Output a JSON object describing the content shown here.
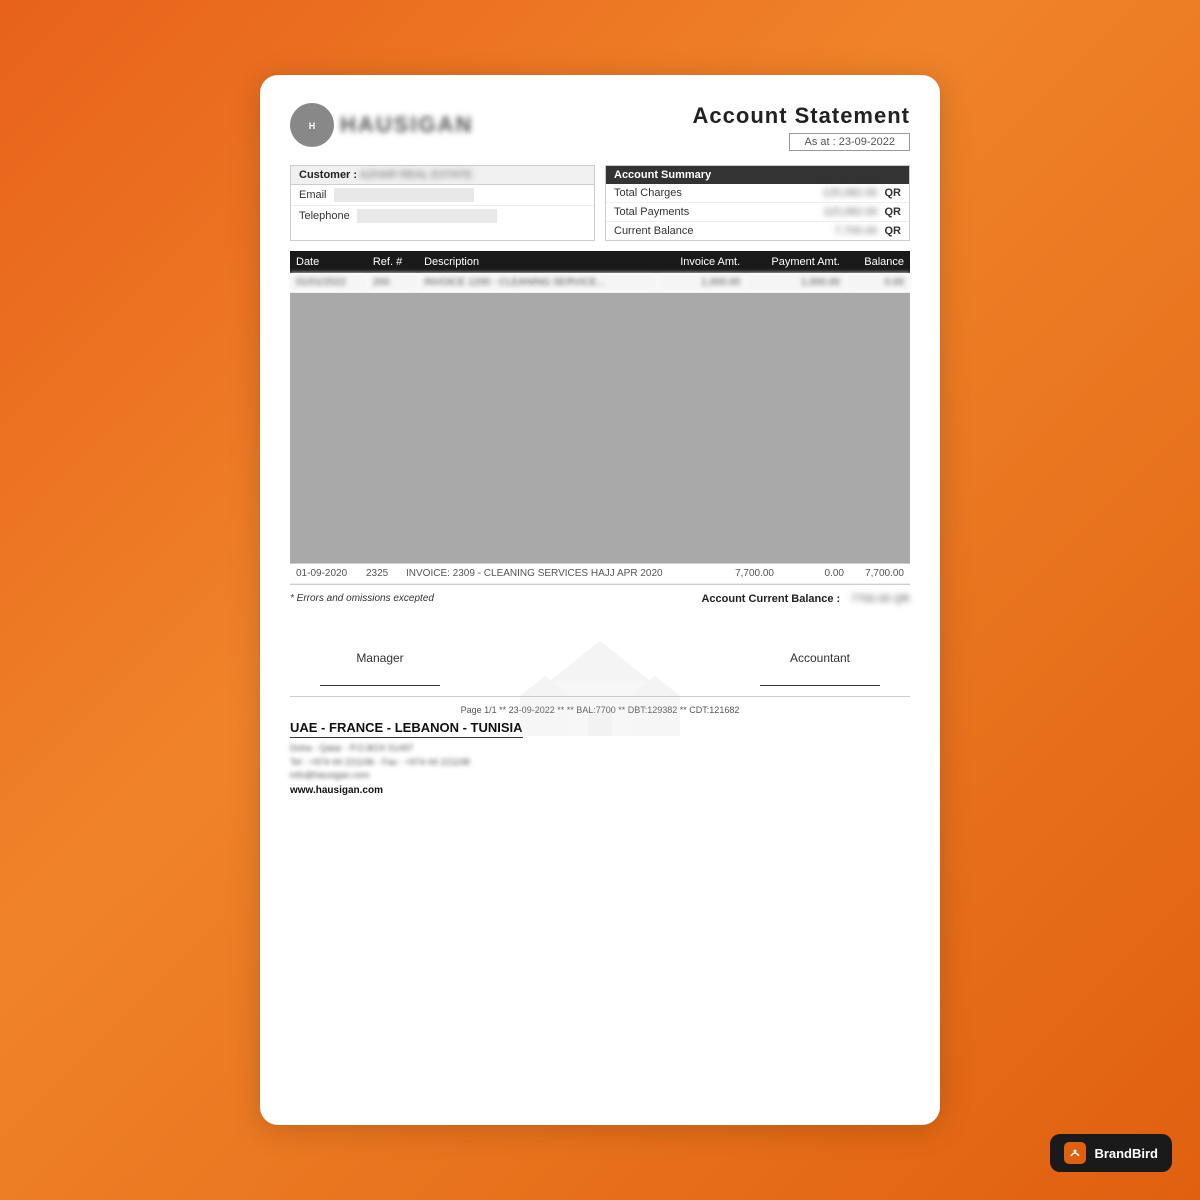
{
  "header": {
    "logo_text": "HAUSIGAN",
    "title": "Account Statement",
    "as_at_label": "As at : 23-09-2022"
  },
  "customer": {
    "label": "Customer :",
    "name": "AZHAR REAL ESTATE",
    "email_label": "Email",
    "telephone_label": "Telephone"
  },
  "account_summary": {
    "title": "Account Summary",
    "rows": [
      {
        "label": "Total Charges",
        "value": "125,082.00",
        "currency": "QR"
      },
      {
        "label": "Total Payments",
        "value": "115,082.00",
        "currency": "QR"
      },
      {
        "label": "Current Balance",
        "value": "7,700.00",
        "currency": "QR"
      }
    ]
  },
  "table": {
    "headers": [
      "Date",
      "Ref. #",
      "Description",
      "Invoice Amt.",
      "Payment Amt.",
      "Balance"
    ],
    "first_row": {
      "date": "01/01/2022",
      "ref": "200",
      "description": "INVOICE 1200 - CLEANING SERVICE...",
      "invoice_amt": "1,000.00",
      "payment_amt": "1,000.00",
      "balance": "0.00"
    },
    "last_row": {
      "date": "01-09-2020",
      "ref": "2325",
      "description": "INVOICE: 2309 - CLEANING SERVICES HAJJ APR 2020",
      "invoice_amt": "7,700.00",
      "payment_amt": "0.00",
      "balance": "7,700.00"
    }
  },
  "footer": {
    "errors_text": "* Errors and omissions excepted",
    "balance_label": "Account Current Balance :",
    "balance_value": "7700.00 QR",
    "page_meta": "Page 1/1 ** 23-09-2022 **  ** BAL:7700 ** DBT:129382 ** CDT:121682",
    "page_label": "Page 1 of 1"
  },
  "signatures": {
    "manager_label": "Manager",
    "accountant_label": "Accountant"
  },
  "company": {
    "countries": "UAE - FRANCE - LEBANON - TUNISIA",
    "address_line1": "Doha - Qatar - P.O.BOX 51497",
    "address_line2": "Tel : +974-44 221196 - Fax : +974-44 221198",
    "email": "info@hausigan.com",
    "website": "www.hausigan.com"
  },
  "brandbird": {
    "label": "BrandBird"
  }
}
